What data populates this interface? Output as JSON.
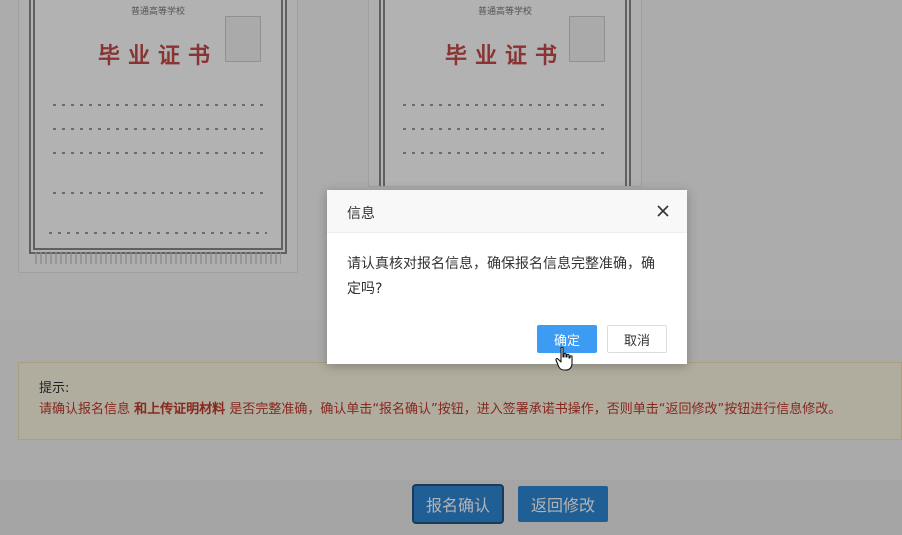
{
  "certificates": [
    {
      "school": "普通高等学校",
      "title": "毕业证书"
    },
    {
      "school": "普通高等学校",
      "title": "毕业证书"
    }
  ],
  "tip": {
    "label": "提示:",
    "text_before": "请确认报名信息",
    "text_bold": "和上传证明材料",
    "text_after": "是否完整准确，确认单击“报名确认”按钮，进入签署承诺书操作，否则单击“返回修改”按钮进行信息修改。"
  },
  "actions": {
    "confirm_label": "报名确认",
    "back_label": "返回修改"
  },
  "dialog": {
    "title": "信息",
    "message": "请认真核对报名信息，确保报名信息完整准确，确定吗?",
    "ok_label": "确定",
    "cancel_label": "取消"
  },
  "colors": {
    "primary": "#2f89d6",
    "dialog_ok": "#3c9cf4",
    "tip_text": "#c23a2d",
    "tip_bg": "#fdf6e3"
  }
}
